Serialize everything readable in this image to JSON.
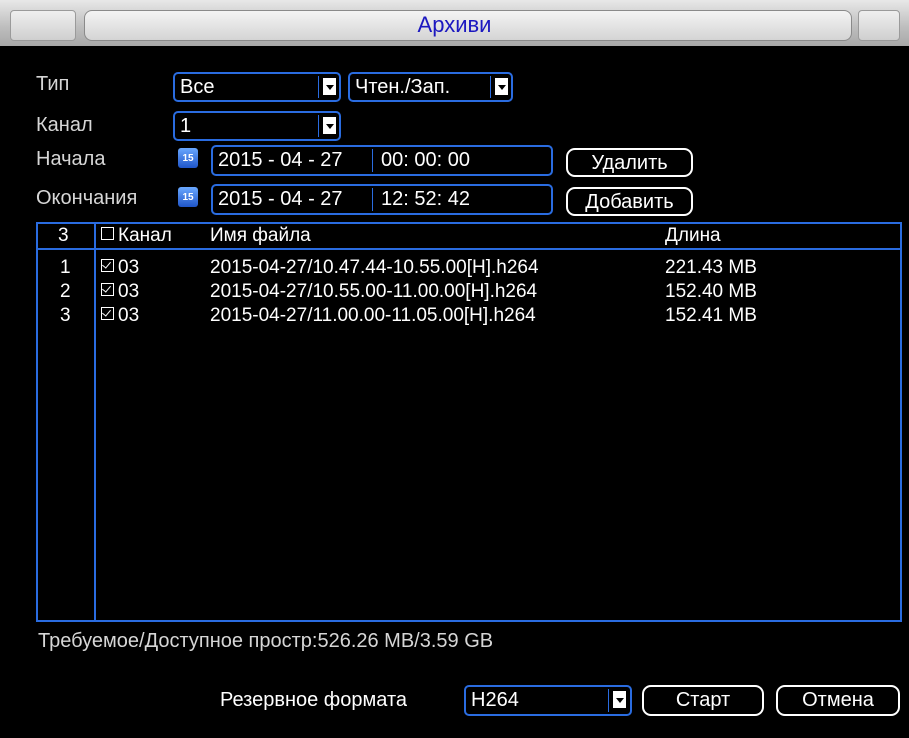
{
  "window": {
    "title": "Архиви"
  },
  "filters": {
    "type_label": "Тип",
    "type_value": "Все",
    "mode_value": "Чтен./Зап.",
    "channel_label": "Канал",
    "channel_value": "1",
    "start_label": "Начала",
    "start_date": "2015 - 04 - 27",
    "start_time": "00: 00: 00",
    "end_label": "Окончания",
    "end_date": "2015 - 04 - 27",
    "end_time": "12: 52: 42",
    "delete_label": "Удалить",
    "add_label": "Добавить",
    "calendar_icon_text": "15"
  },
  "table": {
    "count": "3",
    "headers": {
      "channel": "Канал",
      "filename": "Имя файла",
      "length": "Длина"
    },
    "rows": [
      {
        "index": "1",
        "checked": true,
        "channel": "03",
        "filename": "2015-04-27/10.47.44-10.55.00[H].h264",
        "length": "221.43 MB"
      },
      {
        "index": "2",
        "checked": true,
        "channel": "03",
        "filename": "2015-04-27/10.55.00-11.00.00[H].h264",
        "length": "152.40 MB"
      },
      {
        "index": "3",
        "checked": true,
        "channel": "03",
        "filename": "2015-04-27/11.00.00-11.05.00[H].h264",
        "length": "152.41 MB"
      }
    ]
  },
  "space": "Требуемое/Доступное простр:526.26 MB/3.59 GB",
  "backup": {
    "format_label": "Резервное формата",
    "format_value": "H264",
    "start_label": "Старт",
    "cancel_label": "Отмена"
  },
  "colors": {
    "accent": "#2a6ce0",
    "title_text": "#1c18c0",
    "background": "#000000"
  }
}
